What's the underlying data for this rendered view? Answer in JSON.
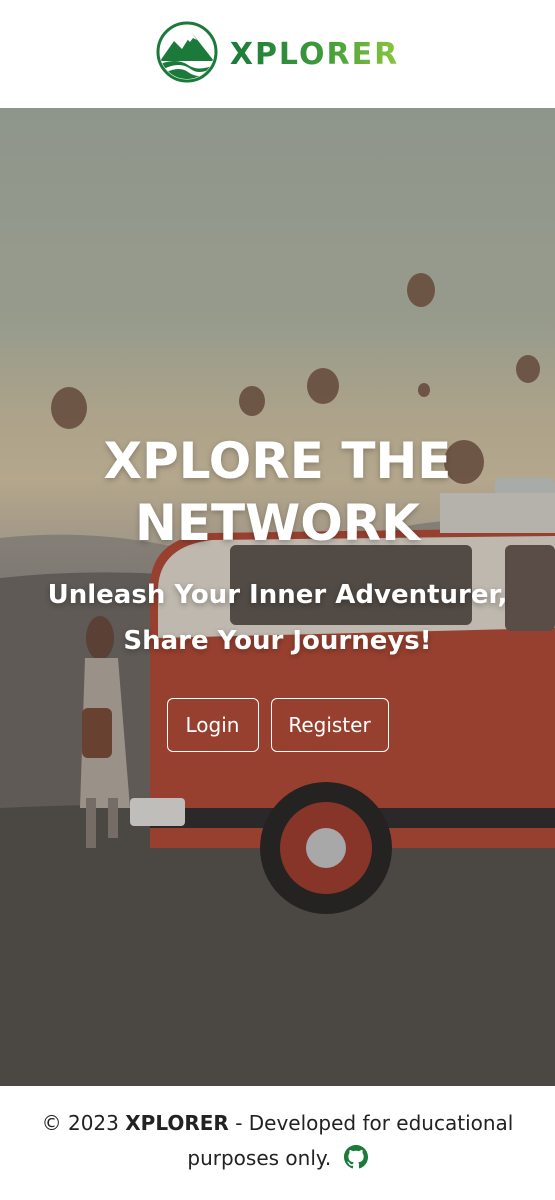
{
  "header": {
    "brand_name": "XPLORER",
    "logo_icon": "mountain-logo-icon",
    "brand_colors": [
      "#1b7a3a",
      "#8cc63f"
    ]
  },
  "hero": {
    "title": "XPLORE THE NETWORK",
    "subtitle": "Unleash Your Inner Adventurer, Share Your Journeys!",
    "buttons": {
      "login_label": "Login",
      "register_label": "Register"
    }
  },
  "footer": {
    "copyright_symbol_year": "© 2023",
    "brand": "XPLORER",
    "message": "- Developed for educational purposes only.",
    "github_icon": "github-icon"
  }
}
